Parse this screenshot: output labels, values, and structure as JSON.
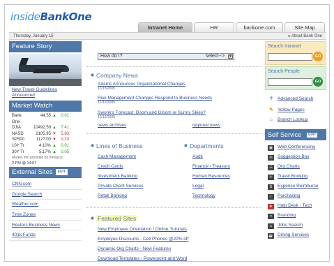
{
  "logo": {
    "pre": "inside",
    "main": "BankOne"
  },
  "tabs": [
    "Intranet Home",
    "HR",
    "bankone.com",
    "Site Map"
  ],
  "datebar": {
    "date": "Thursday, January 15",
    "about": "▸ About Bank One"
  },
  "left": {
    "feature_title": "Feature Story",
    "feature_link": "New Travel Guidelines Announced",
    "market_title": "Market Watch",
    "stocks": [
      {
        "name": "Bank One",
        "price": "44.55",
        "dir": "up",
        "chg": "0.01"
      },
      {
        "name": "DJIA",
        "price": "10492.59",
        "dir": "up",
        "chg": "7.41"
      },
      {
        "name": "NASD",
        "price": "2105.95",
        "dir": "down",
        "chg": "5.83"
      },
      {
        "name": "SP500",
        "price": "1127.00",
        "dir": "down",
        "chg": "0.23"
      },
      {
        "name": "10Y Tr",
        "price": "4.10%",
        "dir": "up",
        "chg": "0.01"
      },
      {
        "name": "30Y Tr",
        "price": "5.17%",
        "dir": "up",
        "chg": "0.05"
      }
    ],
    "provided": "Market info provided by Pinnacor",
    "time": "2 PM @ 14:07",
    "external_title": "External Sites",
    "edit": "EDIT",
    "external_sites": [
      "CNN.com",
      "Google Search",
      "Weather.com",
      "Time Zones",
      "Reuters Business News",
      "401k Funds"
    ]
  },
  "center": {
    "howdoi": "How do I?",
    "select": "select-->",
    "company_news_title": "Company News",
    "news": [
      {
        "title": "Adams Announces Organizational Changes",
        "date": "12/15/2005"
      },
      {
        "title": "Risk Management Changes Respond to Business Needs",
        "date": "12/12/2005"
      },
      {
        "title": "Swonk's Forecast: Doom and Gloom or Sunny Skies?",
        "date": "12/12/2005"
      }
    ],
    "news_archives": "news archives",
    "regional_news": "regional news",
    "lob_title": "Lines of Business",
    "lob": [
      "Cash Management",
      "Credit Cards",
      "Investment Banking",
      "Private Client Services",
      "Retail Banking"
    ],
    "dept_title": "Departments",
    "depts": [
      "Audit",
      "Finance / Treasury",
      "Human Resources",
      "Legal",
      "Technology"
    ],
    "featured_title": "Featured Sites",
    "featured": [
      "New Employee Orientation / Online Tutorials",
      "Employee Discounts - Cell Phones @20% off",
      "Dynamic Org Charts - New Features",
      "Download Templates - Powerpoint and Word"
    ]
  },
  "right": {
    "search_intranet": "Search Intranet",
    "search_people": "Search People",
    "go": "GO",
    "tools": [
      {
        "icon": "?",
        "label": "Advanced Search",
        "color": "#2a4fa0"
      },
      {
        "icon": "✎",
        "label": "Yellow Pages",
        "color": "#d6a000"
      },
      {
        "icon": "⌂",
        "label": "Branch Lookup",
        "color": "#2a4fa0"
      }
    ],
    "self_service_title": "Self Service",
    "edit": "EDIT",
    "self_service": [
      {
        "icon": "▣",
        "label": "Web Conferencing"
      },
      {
        "icon": "✉",
        "label": "Suggestion Box"
      },
      {
        "icon": "☷",
        "label": "Org Charts"
      },
      {
        "icon": "✈",
        "label": "Travel Booking"
      },
      {
        "icon": "$",
        "label": "Expense Reimburse"
      },
      {
        "icon": "✓",
        "label": "Purchasing"
      },
      {
        "icon": "✚",
        "label": "Help Desk - Tech"
      },
      {
        "icon": "□",
        "label": "Branding"
      },
      {
        "icon": "☺",
        "label": "Jobs Search"
      },
      {
        "icon": "☕",
        "label": "Dining Services"
      }
    ]
  }
}
